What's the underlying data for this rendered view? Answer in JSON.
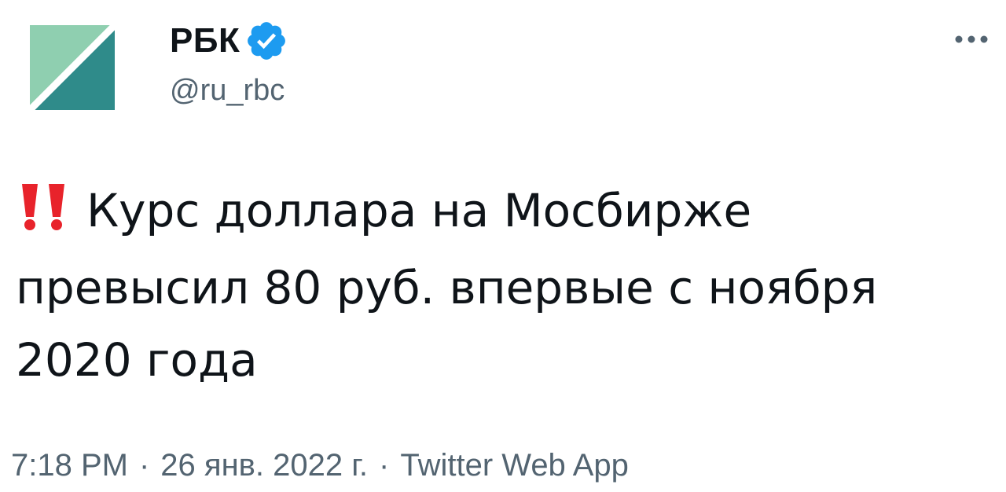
{
  "author": {
    "name": "РБК",
    "handle": "@ru_rbc",
    "verified_icon": "verified-badge-icon",
    "avatar_colors": {
      "top_left": "#8fcfb0",
      "bottom_right": "#2f8b8a",
      "diagonal": "#ffffff"
    }
  },
  "tweet": {
    "emoji": "‼️",
    "text": "Курс доллара на Мосбирже превысил 80 руб. впервые с ноября 2020 года"
  },
  "meta": {
    "time": "7:18 PM",
    "separator": "·",
    "date": "26 янв. 2022 г.",
    "source": "Twitter Web App"
  },
  "colors": {
    "text": "#0f1419",
    "secondary": "#536471",
    "verified": "#1d9bf0",
    "alert": "#e8232b"
  }
}
